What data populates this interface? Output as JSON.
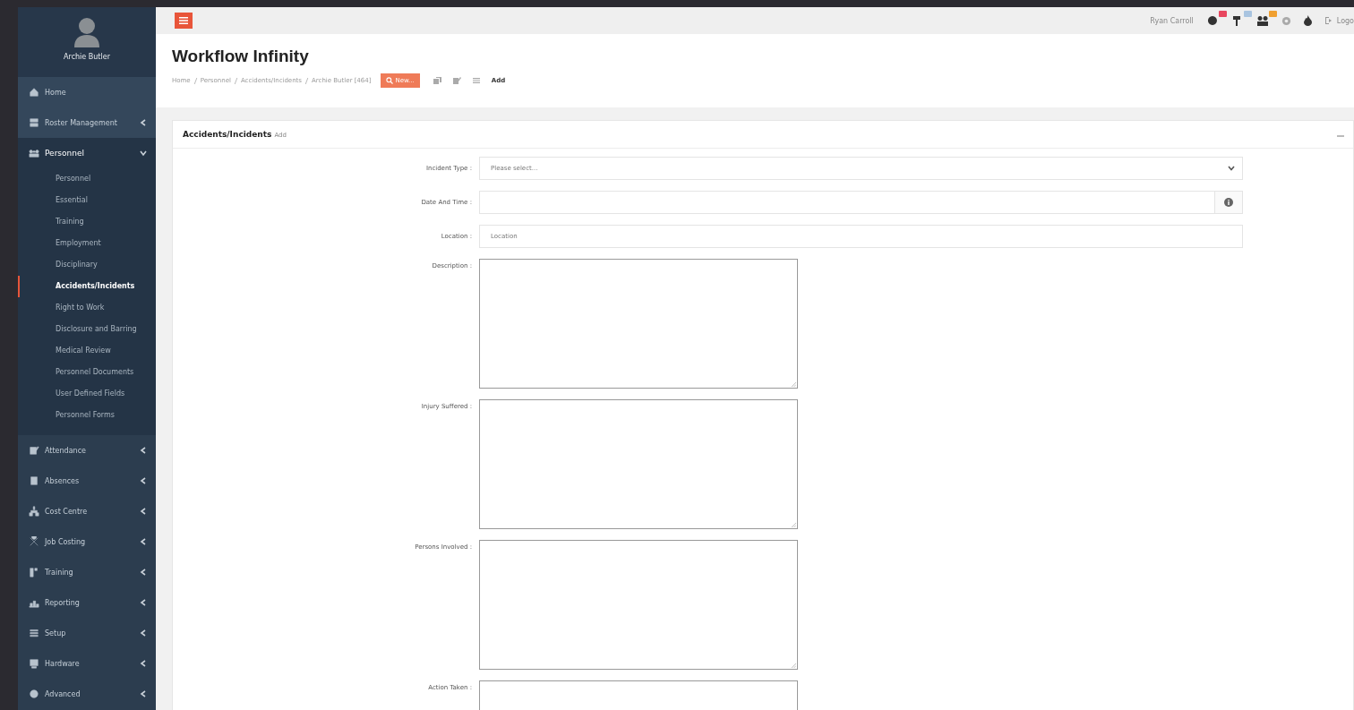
{
  "user": {
    "name": "Archie Butler"
  },
  "sidebar": {
    "items": [
      {
        "label": "Home",
        "kind": "link",
        "expanded": false
      },
      {
        "label": "Roster Management",
        "kind": "menu",
        "expanded": false
      },
      {
        "label": "Personnel",
        "kind": "menu",
        "expanded": true,
        "children": [
          {
            "label": "Personnel",
            "selected": false
          },
          {
            "label": "Essential",
            "selected": false
          },
          {
            "label": "Training",
            "selected": false
          },
          {
            "label": "Employment",
            "selected": false
          },
          {
            "label": "Disciplinary",
            "selected": false
          },
          {
            "label": "Accidents/Incidents",
            "selected": true
          },
          {
            "label": "Right to Work",
            "selected": false
          },
          {
            "label": "Disclosure and Barring",
            "selected": false
          },
          {
            "label": "Medical Review",
            "selected": false
          },
          {
            "label": "Personnel Documents",
            "selected": false
          },
          {
            "label": "User Defined Fields",
            "selected": false
          },
          {
            "label": "Personnel Forms",
            "selected": false
          }
        ]
      },
      {
        "label": "Attendance",
        "kind": "menu",
        "expanded": false
      },
      {
        "label": "Absences",
        "kind": "menu",
        "expanded": false
      },
      {
        "label": "Cost Centre",
        "kind": "menu",
        "expanded": false
      },
      {
        "label": "Job Costing",
        "kind": "menu",
        "expanded": false
      },
      {
        "label": "Training",
        "kind": "menu",
        "expanded": false
      },
      {
        "label": "Reporting",
        "kind": "menu",
        "expanded": false
      },
      {
        "label": "Setup",
        "kind": "menu",
        "expanded": false
      },
      {
        "label": "Hardware",
        "kind": "menu",
        "expanded": false
      },
      {
        "label": "Advanced",
        "kind": "menu",
        "expanded": false
      }
    ]
  },
  "topbar": {
    "user": "Ryan Carroll",
    "notifications": [
      {
        "color": "#e8475f"
      },
      {
        "color": "#a9c4e0"
      },
      {
        "color": "#f0a030"
      }
    ],
    "logout": "Logo"
  },
  "page": {
    "title": "Workflow Infinity",
    "breadcrumb": [
      "Home",
      "Personnel",
      "Accidents/Incidents",
      "Archie Butler [464]"
    ],
    "new_button": "New...",
    "current": "Add"
  },
  "panel": {
    "title": "Accidents/Incidents",
    "subtitle": "Add",
    "fields": [
      {
        "label": "Incident Type :",
        "kind": "select",
        "placeholder": "Please select..."
      },
      {
        "label": "Date And Time :",
        "kind": "addon"
      },
      {
        "label": "Location :",
        "kind": "input",
        "placeholder": "Location"
      },
      {
        "label": "Description :",
        "kind": "textarea"
      },
      {
        "label": "Injury Suffered :",
        "kind": "textarea"
      },
      {
        "label": "Persons Involved :",
        "kind": "textarea"
      },
      {
        "label": "Action Taken :",
        "kind": "textarea"
      }
    ]
  }
}
